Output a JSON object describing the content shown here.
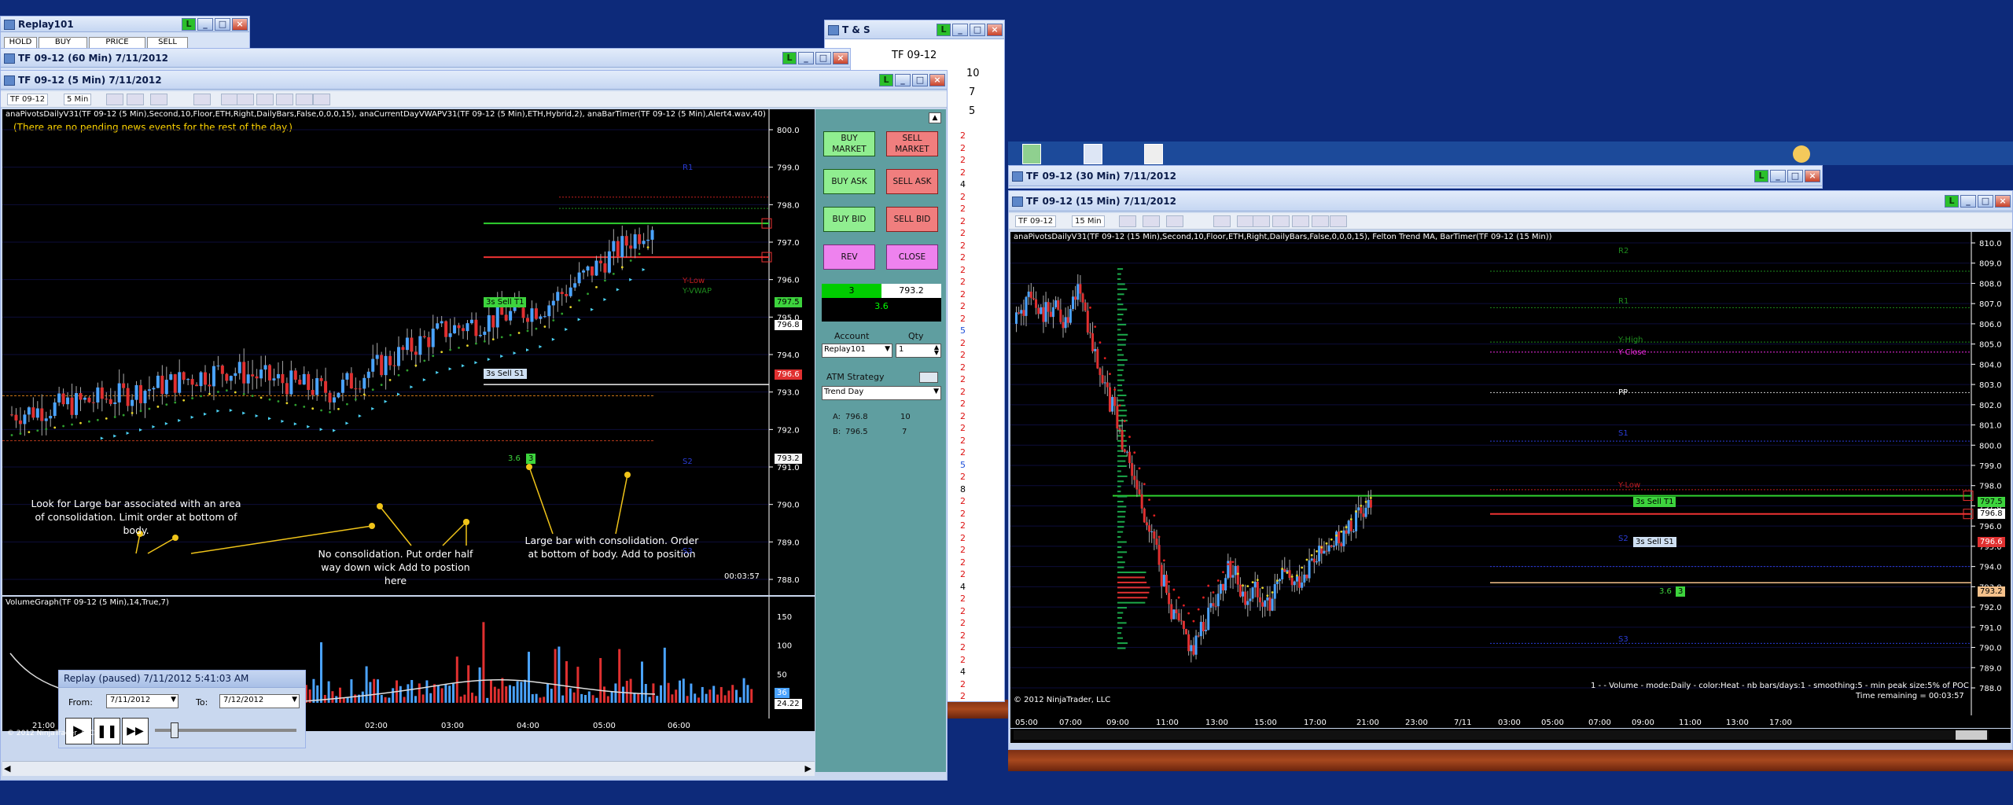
{
  "replay101_window": {
    "title": "Replay101",
    "buttons": [
      "HOLD",
      "BUY",
      "PRICE",
      "SELL"
    ]
  },
  "tf60_window": {
    "title": "TF 09-12 (60 Min)  7/11/2012"
  },
  "tns_window": {
    "title": "T & S",
    "symbol": "TF 09-12",
    "rows": [
      "10",
      "7",
      "5"
    ],
    "sizes": [
      "2",
      "2",
      "2",
      "2",
      "4",
      "2",
      "2",
      "2",
      "2",
      "2",
      "2",
      "2",
      "2",
      "2",
      "2",
      "2",
      "5",
      "2",
      "2",
      "2",
      "2",
      "2",
      "2",
      "2",
      "2",
      "2",
      "2",
      "5",
      "2",
      "8",
      "2",
      "2",
      "2",
      "2",
      "2",
      "2",
      "2",
      "4",
      "2",
      "2",
      "2",
      "2",
      "2",
      "2",
      "4",
      "2",
      "2"
    ]
  },
  "tf5_window": {
    "title": "TF 09-12 (5 Min)  7/11/2012",
    "toolbar": {
      "instrument": "TF 09-12",
      "interval": "5 Min"
    },
    "indicators": "anaPivotsDailyV31(TF 09-12 (5 Min),Second,10,Floor,ETH,Right,DailyBars,False,0,0,0,15), anaCurrentDayVWAPV31(TF 09-12 (5 Min),ETH,Hybrid,2), anaBarTimer(TF 09-12 (5 Min),Alert4.wav,40)",
    "news_msg": "(There are no pending news events for the rest of the day.)",
    "y_ticks": [
      "800.0",
      "799.0",
      "798.0",
      "797.0",
      "796.0",
      "795.0",
      "794.0",
      "793.0",
      "792.0",
      "791.0",
      "790.0",
      "789.0",
      "788.0"
    ],
    "price_tags": [
      "797.5",
      "796.8",
      "796.6",
      "793.2"
    ],
    "level_labels": {
      "ylow": "Y-Low",
      "yvwap": "Y-VWAP",
      "s2": "S2",
      "s3": "S3",
      "r1": "R1"
    },
    "order_tags": {
      "sell_t1": "3s  Sell T1",
      "sell_s1": "3s  Sell S1",
      "qty": "3",
      "profit": "3.6"
    },
    "timer": "00:03:57",
    "annotations": [
      "Look for Large bar associated with an area of consolidation. Limit order at bottom of body.",
      "No consolidation. Put order half way down wick Add to postion here",
      "Large bar with consolidation. Order at bottom of body. Add to position"
    ],
    "volume_label": "VolumeGraph(TF 09-12 (5 Min),14,True,7)",
    "volume_ticks": [
      "150",
      "100",
      "50",
      "0"
    ],
    "volume_tags": [
      "36",
      "24.22"
    ],
    "x_ticks": [
      "21:00",
      "01:00",
      "02:00",
      "03:00",
      "04:00",
      "05:00",
      "06:00"
    ],
    "copyright": "© 2012 NinjaTrader, LLC",
    "chart_data": {
      "type": "line",
      "title": "TF 09-12 (5 Min)  7/11/2012",
      "x": [
        "21:00",
        "01:00",
        "02:00",
        "03:00",
        "04:00",
        "05:00",
        "06:00"
      ],
      "ylim": [
        788.0,
        800.0
      ],
      "series": [
        {
          "name": "Price",
          "values": [
            792.4,
            792.9,
            793.6,
            793.0,
            794.6,
            795.3,
            797.5
          ]
        }
      ],
      "levels": {
        "Y-Low": 798.2,
        "Y-VWAP": 797.9,
        "S1": 796.6,
        "S2": 793.2,
        "S3": 792.0
      }
    }
  },
  "chart_trader": {
    "buy_market": "BUY MARKET",
    "sell_market": "SELL MARKET",
    "buy_ask": "BUY ASK",
    "sell_ask": "SELL ASK",
    "buy_bid": "BUY BID",
    "sell_bid": "SELL BID",
    "rev": "REV",
    "close": "CLOSE",
    "position_qty": "3",
    "position_price": "793.2",
    "pnl": "3.6",
    "account_label": "Account",
    "qty_label": "Qty",
    "account": "Replay101",
    "qty": "1",
    "atm_label": "ATM Strategy",
    "atm": "Trend Day",
    "a_label": "A:",
    "a_price": "796.8",
    "a_qty": "10",
    "b_label": "B:",
    "b_price": "796.5",
    "b_qty": "7"
  },
  "replay_panel": {
    "title": "Replay (paused) 7/11/2012 5:41:03 AM",
    "from_label": "From:",
    "from": "7/11/2012",
    "to_label": "To:",
    "to": "7/12/2012"
  },
  "tf30_window": {
    "title": "TF 09-12 (30 Min)  7/11/2012"
  },
  "tf15_window": {
    "title": "TF 09-12 (15 Min)  7/11/2012",
    "toolbar": {
      "instrument": "TF 09-12",
      "interval": "15 Min"
    },
    "indicators": "anaPivotsDailyV31(TF 09-12 (15 Min),Second,10,Floor,ETH,Right,DailyBars,False,0,0,0,15), Felton Trend MA, BarTimer(TF 09-12 (15 Min))",
    "y_ticks": [
      "810.0",
      "809.0",
      "808.0",
      "807.0",
      "806.0",
      "805.0",
      "804.0",
      "803.0",
      "802.0",
      "801.0",
      "800.0",
      "799.0",
      "798.0",
      "797.0",
      "796.0",
      "795.0",
      "794.0",
      "793.0",
      "792.0",
      "791.0",
      "790.0",
      "789.0",
      "788.0"
    ],
    "level_labels": {
      "r2": "R2",
      "r1": "R1",
      "yhigh": "Y-High",
      "yclose": "Y-Close",
      "pp": "PP",
      "s1": "S1",
      "ylow": "Y-Low",
      "s2": "S2",
      "s3": "S3"
    },
    "price_tags": [
      "797.5",
      "796.8",
      "796.6",
      "793.2"
    ],
    "order_tags": {
      "sell_t1": "3s  Sell T1",
      "sell_s1": "3s  Sell S1",
      "qty": "3",
      "profit": "3.6"
    },
    "x_ticks": [
      "05:00",
      "07:00",
      "09:00",
      "11:00",
      "13:00",
      "15:00",
      "17:00",
      "21:00",
      "23:00",
      "7/11",
      "03:00",
      "05:00",
      "07:00",
      "09:00",
      "11:00",
      "13:00",
      "17:00"
    ],
    "footer": "1 -  - Volume - mode:Daily - color:Heat - nb bars/days:1 - smoothing:5 - min peak size:5% of POC",
    "time_remaining": "Time remaining = 00:03:57",
    "copyright": "© 2012 NinjaTrader, LLC"
  },
  "colors": {
    "desktop": "#0d2a7a",
    "chart_bg": "#000000",
    "up_bar": "#4aa3ff",
    "down_bar": "#e03030",
    "trader_panel": "#5f9ea0"
  }
}
